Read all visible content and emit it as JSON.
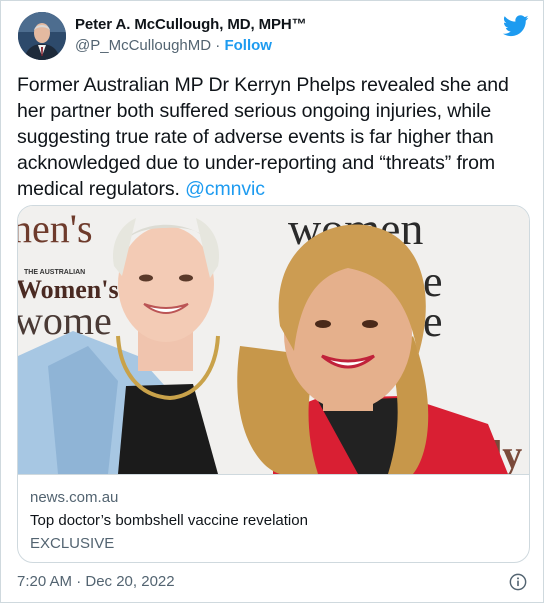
{
  "author": {
    "name": "Peter A. McCullough, MD, MPH™",
    "handle": "@P_McCulloughMD",
    "separator": "·",
    "follow_label": "Follow"
  },
  "tweet": {
    "text": "Former Australian MP Dr Kerryn Phelps revealed she and her partner both suffered serious ongoing injuries, while suggesting true rate of adverse events is far higher than acknowledged due to under-reporting and “threats” from medical regulators.",
    "mention": "@cmnvic"
  },
  "link_card": {
    "domain": "news.com.au",
    "headline": "Top doctor’s bombshell vaccine revelation",
    "description": "EXCLUSIVE",
    "image_text": {
      "magazine_top": "nen's",
      "magazine_brand_small": "THE AUSTRALIAN",
      "magazine_brand": "Women's W",
      "backdrop_women": "women",
      "backdrop_left_word": "wome",
      "backdrop_letter_e": "e",
      "backdrop_letter_dy": "dy"
    }
  },
  "timestamp": "7:20 AM · Dec 20, 2022",
  "icons": {
    "twitter": "twitter-bird-icon",
    "info": "info-icon"
  },
  "colors": {
    "accent": "#1d9bf0",
    "text": "#0f1419",
    "secondary": "#536471",
    "border": "#cfd9de"
  }
}
